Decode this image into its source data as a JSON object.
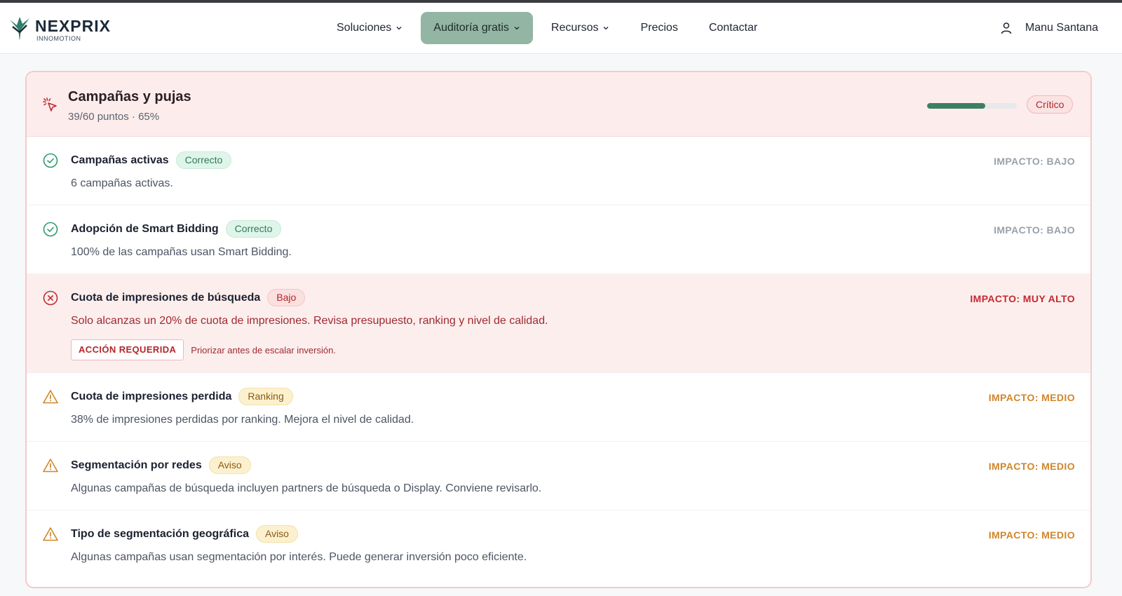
{
  "brand": {
    "name": "NEXPRIX",
    "tagline": "INNOMOTION"
  },
  "nav": {
    "items": [
      {
        "label": "Soluciones",
        "dropdown": true
      },
      {
        "label": "Auditoría gratis",
        "dropdown": true,
        "active": true
      },
      {
        "label": "Recursos",
        "dropdown": true
      },
      {
        "label": "Precios",
        "dropdown": false
      },
      {
        "label": "Contactar",
        "dropdown": false
      }
    ],
    "user": "Manu Santana"
  },
  "section": {
    "title": "Campañas y pujas",
    "subtitle": "39/60 puntos · 65%",
    "progress_percent": 65,
    "status": "Crítico"
  },
  "checks": [
    {
      "title": "Campañas activas",
      "tag": "Correcto",
      "status": "ok",
      "description": "6 campañas activas.",
      "impact": "IMPACTO: BAJO"
    },
    {
      "title": "Adopción de Smart Bidding",
      "tag": "Correcto",
      "status": "ok",
      "description": "100% de las campañas usan Smart Bidding.",
      "impact": "IMPACTO: BAJO"
    },
    {
      "title": "Cuota de impresiones de búsqueda",
      "tag": "Bajo",
      "status": "error",
      "description": "Solo alcanzas un 20% de cuota de impresiones. Revisa presupuesto, ranking y nivel de calidad.",
      "impact": "IMPACTO: MUY ALTO",
      "action_label": "ACCIÓN REQUERIDA",
      "action_note": "Priorizar antes de escalar inversión."
    },
    {
      "title": "Cuota de impresiones perdida",
      "tag": "Ranking",
      "status": "warning",
      "description": "38% de impresiones perdidas por ranking. Mejora el nivel de calidad.",
      "impact": "IMPACTO: MEDIO"
    },
    {
      "title": "Segmentación por redes",
      "tag": "Aviso",
      "status": "warning",
      "description": "Algunas campañas de búsqueda incluyen partners de búsqueda o Display. Conviene revisarlo.",
      "impact": "IMPACTO: MEDIO"
    },
    {
      "title": "Tipo de segmentación geográfica",
      "tag": "Aviso",
      "status": "warning",
      "description": "Algunas campañas usan segmentación por interés. Puede generar inversión poco eficiente.",
      "impact": "IMPACTO: MEDIO"
    }
  ],
  "colors": {
    "accent": "#93b5a4",
    "progress": "#3d7f62",
    "critical": "#c22a2e",
    "warning": "#d0862a",
    "ok": "#2f9a6a"
  }
}
